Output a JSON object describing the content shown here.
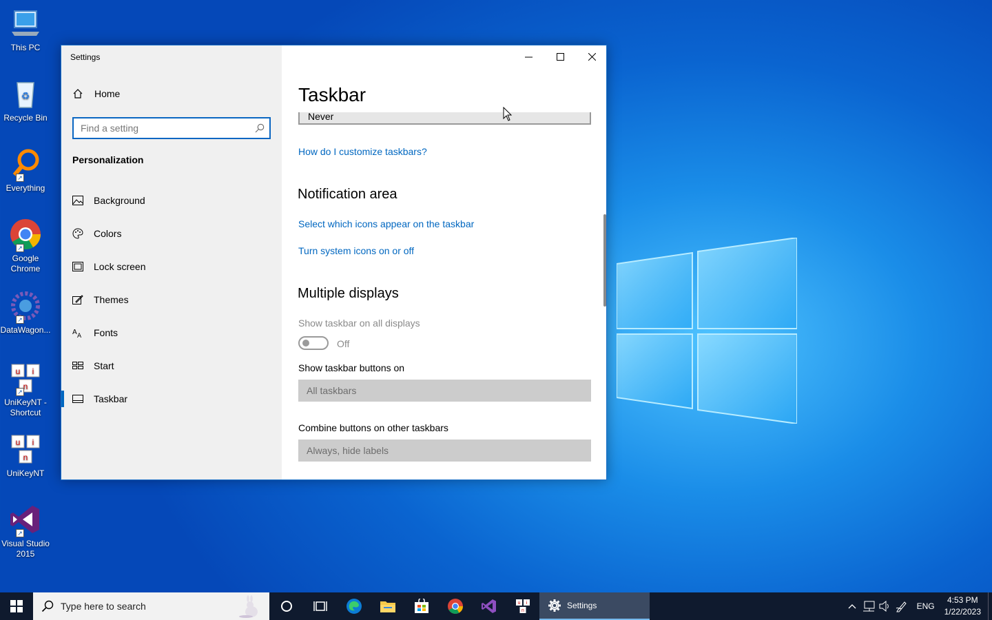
{
  "desktop": {
    "icons": [
      {
        "label": "This PC"
      },
      {
        "label": "Recycle Bin"
      },
      {
        "label": "Everything"
      },
      {
        "label": "Google Chrome"
      },
      {
        "label": "DataWagon..."
      },
      {
        "label": "UniKeyNT - Shortcut"
      },
      {
        "label": "UniKeyNT"
      },
      {
        "label": "Visual Studio 2015"
      }
    ]
  },
  "window": {
    "title": "Settings",
    "sidebar": {
      "home": "Home",
      "search_placeholder": "Find a setting",
      "section": "Personalization",
      "items": [
        {
          "label": "Background"
        },
        {
          "label": "Colors"
        },
        {
          "label": "Lock screen"
        },
        {
          "label": "Themes"
        },
        {
          "label": "Fonts"
        },
        {
          "label": "Start"
        },
        {
          "label": "Taskbar"
        }
      ]
    },
    "content": {
      "page_title": "Taskbar",
      "top_dropdown_value": "Never",
      "link_customize": "How do I customize taskbars?",
      "notification_heading": "Notification area",
      "link_select_icons": "Select which icons appear on the taskbar",
      "link_system_icons": "Turn system icons on or off",
      "multiple_displays_heading": "Multiple displays",
      "show_all_displays_label": "Show taskbar on all displays",
      "show_all_displays_state": "Off",
      "show_buttons_on_label": "Show taskbar buttons on",
      "show_buttons_on_value": "All taskbars",
      "combine_label": "Combine buttons on other taskbars",
      "combine_value": "Always, hide labels"
    }
  },
  "taskbar": {
    "search_placeholder": "Type here to search",
    "active_app": "Settings",
    "language": "ENG",
    "time": "4:53 PM",
    "date": "1/22/2023"
  },
  "colors": {
    "accent": "#0067c0",
    "taskbar": "#0f1a2e"
  }
}
